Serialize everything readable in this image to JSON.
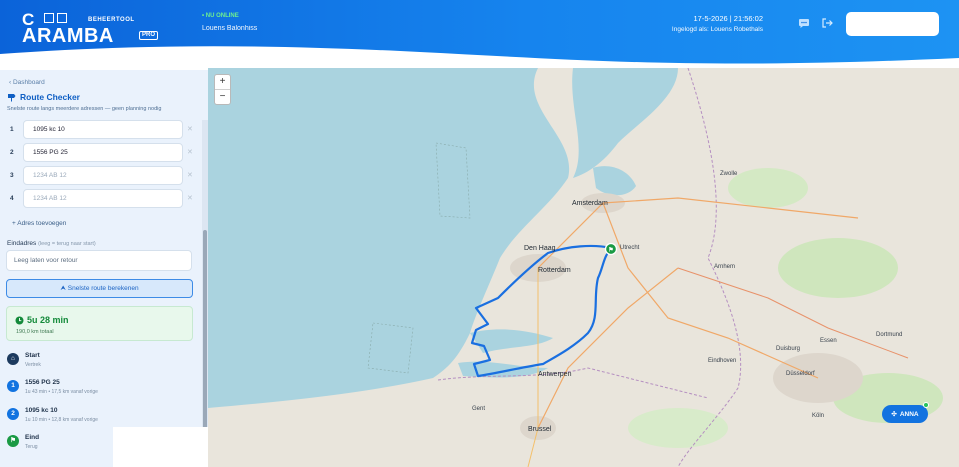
{
  "header": {
    "logo_c": "C",
    "logo_main": "ARAMBA",
    "logo_tag": "BEHEERTOOL",
    "logo_pro": "PRO",
    "online_status": "• NU ONLINE",
    "user_name": "Louens Balonhiss",
    "datetime": "17-5-2026 | 21:56:02",
    "logged_in_as": "Ingelogd als: Louens Robethals"
  },
  "sidebar": {
    "back": "‹ Dashboard",
    "title": "Route Checker",
    "subtitle": "Snelste route langs meerdere adressen — geen planning nodig",
    "stops": [
      {
        "num": "1",
        "value": "1095 kc 10",
        "placeholder": false
      },
      {
        "num": "2",
        "value": "1556 PG 25",
        "placeholder": false
      },
      {
        "num": "3",
        "value": "1234 AB 12",
        "placeholder": true
      },
      {
        "num": "4",
        "value": "1234 AB 12",
        "placeholder": true
      }
    ],
    "add_stop": "+ Adres toevoegen",
    "end_label": "Eindadres",
    "end_optional": "(leeg = terug naar start)",
    "end_placeholder": "Leeg laten voor retour",
    "calc_button": "Snelste route berekenen",
    "result_time": "5u 28 min",
    "result_distance": "190,0 km totaal",
    "steps": [
      {
        "badge": "",
        "title": "Start",
        "sub": "Vertrek",
        "color": "#1c3a5e"
      },
      {
        "badge": "1",
        "title": "1556 PG 25",
        "sub": "1u 43 min • 17,5 km vanaf vorige",
        "color": "#1273e0"
      },
      {
        "badge": "2",
        "title": "1095 kc 10",
        "sub": "1u 10 min • 12,8 km vanaf vorige",
        "color": "#1273e0"
      },
      {
        "badge": "",
        "title": "Eind",
        "sub": "Terug",
        "color": "#1a9a44"
      }
    ]
  },
  "map": {
    "zoom_in": "+",
    "zoom_out": "−",
    "cities": [
      {
        "name": "Amsterdam",
        "big": true
      },
      {
        "name": "Den Haag",
        "big": true
      },
      {
        "name": "Rotterdam",
        "big": true
      },
      {
        "name": "Antwerpen",
        "big": true
      },
      {
        "name": "Brussel",
        "big": true
      },
      {
        "name": "Utrecht",
        "big": false
      },
      {
        "name": "Eindhoven",
        "big": false
      },
      {
        "name": "Düsseldorf",
        "big": false
      },
      {
        "name": "Duisburg",
        "big": false
      },
      {
        "name": "Essen",
        "big": false
      },
      {
        "name": "Köln",
        "big": false
      },
      {
        "name": "Dortmund",
        "big": false
      },
      {
        "name": "Gent",
        "big": false
      },
      {
        "name": "Zwolle",
        "big": false
      },
      {
        "name": "Arnhem",
        "big": false
      }
    ],
    "anna_button": "ANNA"
  },
  "colors": {
    "brand": "#0b63d9",
    "route": "#1a6fe0",
    "success": "#148a3a"
  }
}
